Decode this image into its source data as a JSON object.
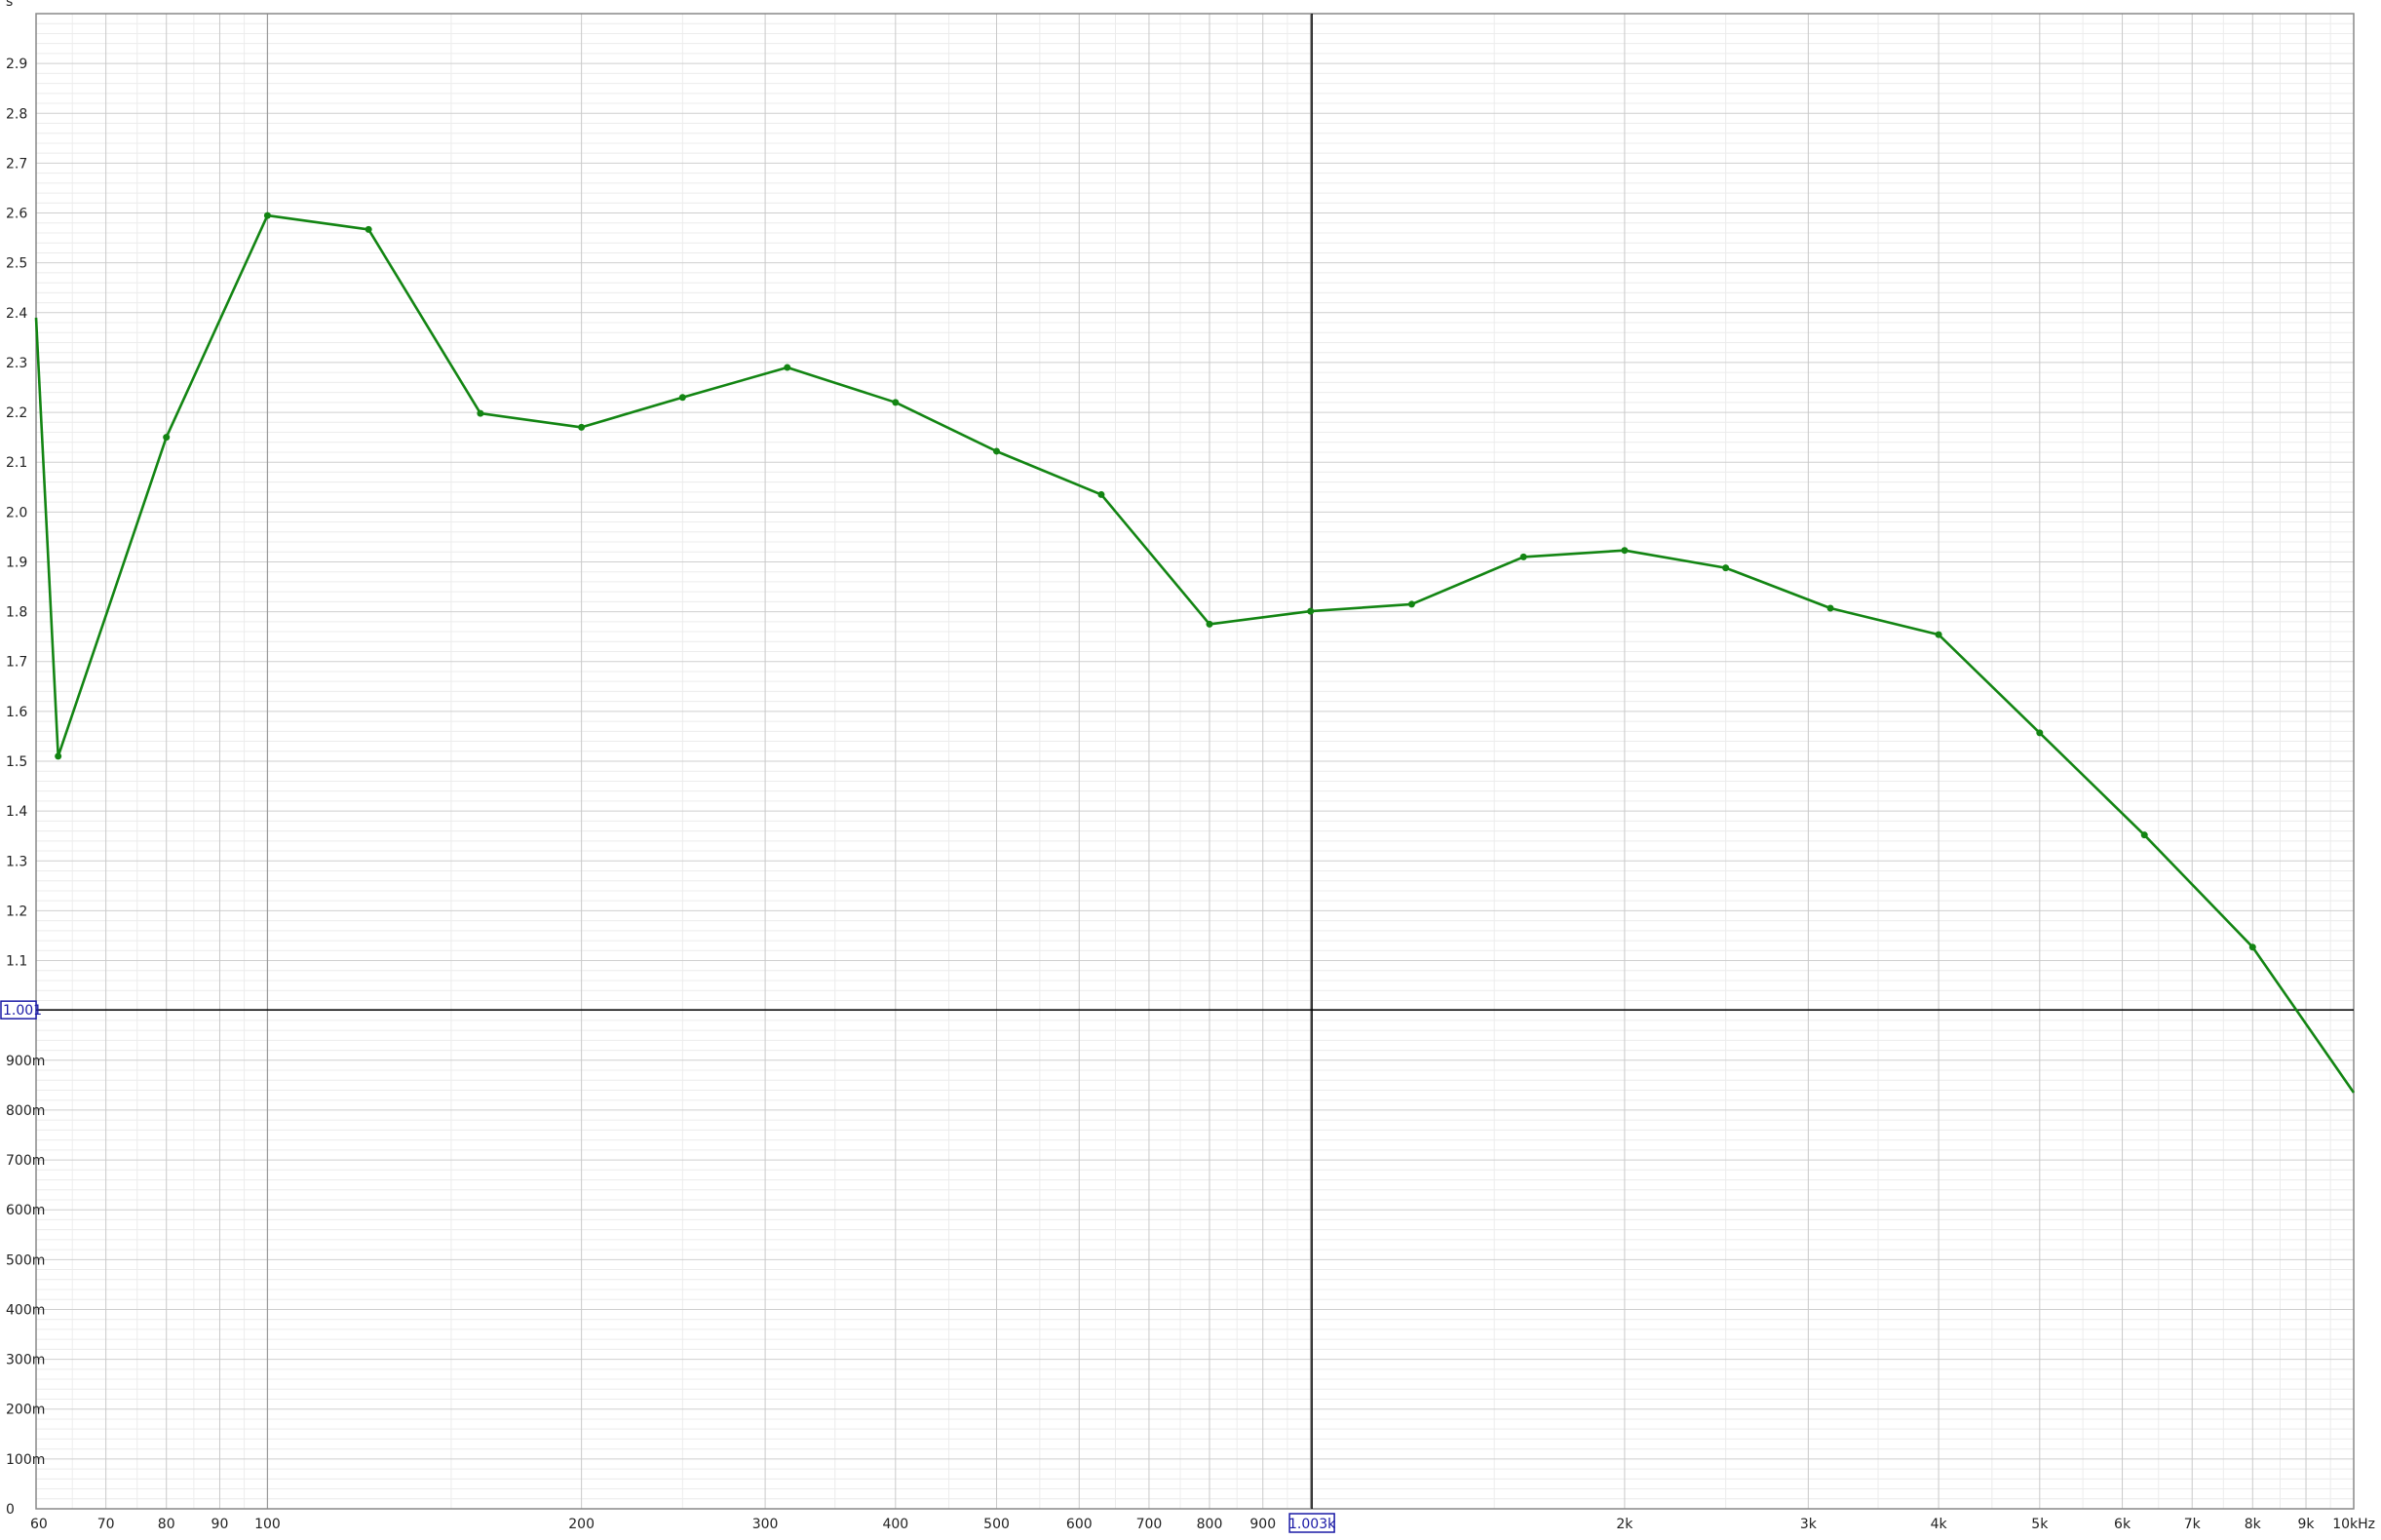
{
  "chart_data": {
    "type": "line",
    "x_scale": "log",
    "x_unit": "kHz",
    "y_unit": "s",
    "xlim": [
      60,
      10000
    ],
    "ylim": [
      0,
      3.0
    ],
    "grid": true,
    "legend": "none",
    "x_tick_labels": [
      {
        "v": 60,
        "label": "60"
      },
      {
        "v": 70,
        "label": "70"
      },
      {
        "v": 80,
        "label": "80"
      },
      {
        "v": 90,
        "label": "90"
      },
      {
        "v": 100,
        "label": "100"
      },
      {
        "v": 200,
        "label": "200"
      },
      {
        "v": 300,
        "label": "300"
      },
      {
        "v": 400,
        "label": "400"
      },
      {
        "v": 500,
        "label": "500"
      },
      {
        "v": 600,
        "label": "600"
      },
      {
        "v": 700,
        "label": "700"
      },
      {
        "v": 800,
        "label": "800"
      },
      {
        "v": 900,
        "label": "900"
      },
      {
        "v": 2000,
        "label": "2k"
      },
      {
        "v": 3000,
        "label": "3k"
      },
      {
        "v": 4000,
        "label": "4k"
      },
      {
        "v": 5000,
        "label": "5k"
      },
      {
        "v": 6000,
        "label": "6k"
      },
      {
        "v": 7000,
        "label": "7k"
      },
      {
        "v": 8000,
        "label": "8k"
      },
      {
        "v": 9000,
        "label": "9k"
      },
      {
        "v": 10000,
        "label": "10kHz"
      }
    ],
    "y_tick_labels": [
      {
        "v": 0,
        "label": "0"
      },
      {
        "v": 0.1,
        "label": "100m"
      },
      {
        "v": 0.2,
        "label": "200m"
      },
      {
        "v": 0.3,
        "label": "300m"
      },
      {
        "v": 0.4,
        "label": "400m"
      },
      {
        "v": 0.5,
        "label": "500m"
      },
      {
        "v": 0.6,
        "label": "600m"
      },
      {
        "v": 0.7,
        "label": "700m"
      },
      {
        "v": 0.8,
        "label": "800m"
      },
      {
        "v": 0.9,
        "label": "900m"
      },
      {
        "v": 1.1,
        "label": "1.1"
      },
      {
        "v": 1.2,
        "label": "1.2"
      },
      {
        "v": 1.3,
        "label": "1.3"
      },
      {
        "v": 1.4,
        "label": "1.4"
      },
      {
        "v": 1.5,
        "label": "1.5"
      },
      {
        "v": 1.6,
        "label": "1.6"
      },
      {
        "v": 1.7,
        "label": "1.7"
      },
      {
        "v": 1.8,
        "label": "1.8"
      },
      {
        "v": 1.9,
        "label": "1.9"
      },
      {
        "v": 2.0,
        "label": "2.0"
      },
      {
        "v": 2.1,
        "label": "2.1"
      },
      {
        "v": 2.2,
        "label": "2.2"
      },
      {
        "v": 2.3,
        "label": "2.3"
      },
      {
        "v": 2.4,
        "label": "2.4"
      },
      {
        "v": 2.5,
        "label": "2.5"
      },
      {
        "v": 2.6,
        "label": "2.6"
      },
      {
        "v": 2.7,
        "label": "2.7"
      },
      {
        "v": 2.8,
        "label": "2.8"
      },
      {
        "v": 2.9,
        "label": "2.9"
      },
      {
        "v": 3.0,
        "label": "s"
      }
    ],
    "cursor": {
      "x": 1003,
      "y": 1.001,
      "x_label": "1.003k",
      "y_label": "1.001"
    },
    "series": [
      {
        "color": "#138513",
        "x": [
          60,
          63,
          80,
          100,
          125,
          160,
          200,
          250,
          315,
          400,
          500,
          630,
          800,
          1000,
          1250,
          1600,
          2000,
          2500,
          3150,
          4000,
          5000,
          6300,
          8000,
          10000
        ],
        "y": [
          2.39,
          1.51,
          2.15,
          2.595,
          2.567,
          2.198,
          2.17,
          2.23,
          2.29,
          2.22,
          2.122,
          2.035,
          1.775,
          1.801,
          1.815,
          1.91,
          1.923,
          1.888,
          1.807,
          1.754,
          1.557,
          1.352,
          1.127,
          0.835
        ]
      }
    ]
  }
}
